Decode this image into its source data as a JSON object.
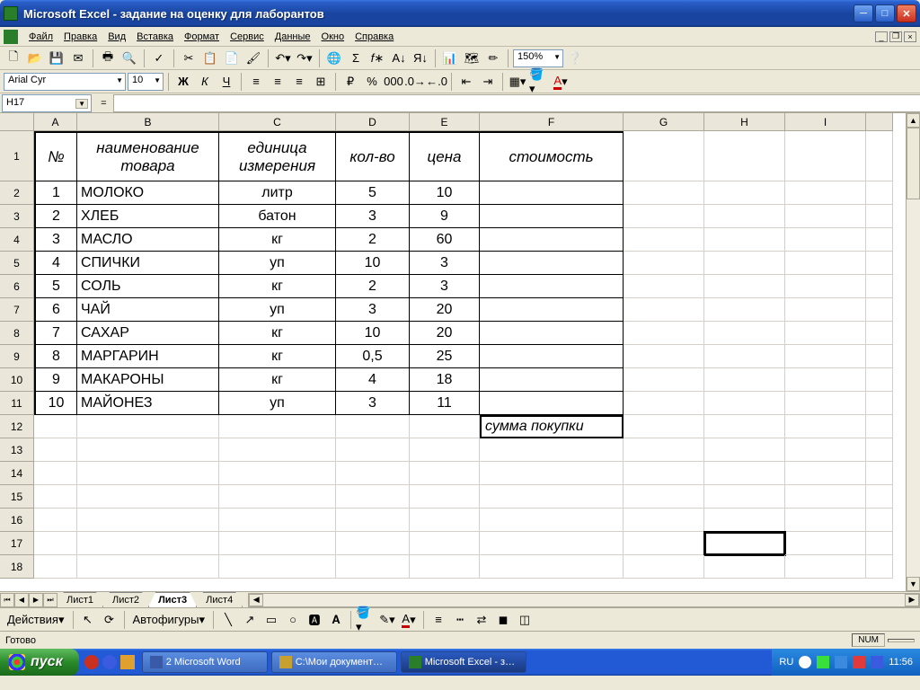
{
  "titlebar": {
    "title": "Microsoft Excel - задание на оценку для лаборантов"
  },
  "menu": {
    "file": "Файл",
    "edit": "Правка",
    "view": "Вид",
    "insert": "Вставка",
    "format": "Формат",
    "tools": "Сервис",
    "data": "Данные",
    "window": "Окно",
    "help": "Справка"
  },
  "toolbar": {
    "zoom": "150%",
    "font": "Arial Cyr",
    "size": "10"
  },
  "namebox": "H17",
  "columns": [
    "A",
    "B",
    "C",
    "D",
    "E",
    "F",
    "G",
    "H",
    "I"
  ],
  "row1": {
    "A": "№",
    "B": "наименование товара",
    "C": "единица измерения",
    "D": "кол-во",
    "E": "цена",
    "F": "стоимость"
  },
  "rows": [
    {
      "n": "1",
      "name": "МОЛОКО",
      "unit": "литр",
      "qty": "5",
      "price": "10"
    },
    {
      "n": "2",
      "name": "ХЛЕБ",
      "unit": "батон",
      "qty": "3",
      "price": "9"
    },
    {
      "n": "3",
      "name": "МАСЛО",
      "unit": "кг",
      "qty": "2",
      "price": "60"
    },
    {
      "n": "4",
      "name": "СПИЧКИ",
      "unit": "уп",
      "qty": "10",
      "price": "3"
    },
    {
      "n": "5",
      "name": "СОЛЬ",
      "unit": "кг",
      "qty": "2",
      "price": "3"
    },
    {
      "n": "6",
      "name": "ЧАЙ",
      "unit": "уп",
      "qty": "3",
      "price": "20"
    },
    {
      "n": "7",
      "name": "САХАР",
      "unit": "кг",
      "qty": "10",
      "price": "20"
    },
    {
      "n": "8",
      "name": "МАРГАРИН",
      "unit": "кг",
      "qty": "0,5",
      "price": "25"
    },
    {
      "n": "9",
      "name": "МАКАРОНЫ",
      "unit": "кг",
      "qty": "4",
      "price": "18"
    },
    {
      "n": "10",
      "name": "МАЙОНЕЗ",
      "unit": "уп",
      "qty": "3",
      "price": "11"
    }
  ],
  "row12F": "сумма покупки",
  "sheets": [
    "Лист1",
    "Лист2",
    "Лист3",
    "Лист4"
  ],
  "activeSheet": 2,
  "drawbar": {
    "actions": "Действия",
    "autoshapes": "Автофигуры"
  },
  "status": {
    "ready": "Готово",
    "num": "NUM"
  },
  "taskbar": {
    "start": "пуск",
    "items": [
      {
        "label": "2 Microsoft Word",
        "color": "#3a5aa8"
      },
      {
        "label": "C:\\Мои документ…",
        "color": "#c8a030"
      },
      {
        "label": "Microsoft Excel - з…",
        "color": "#2a7e2a"
      }
    ],
    "lang": "RU",
    "clock": "11:56"
  }
}
